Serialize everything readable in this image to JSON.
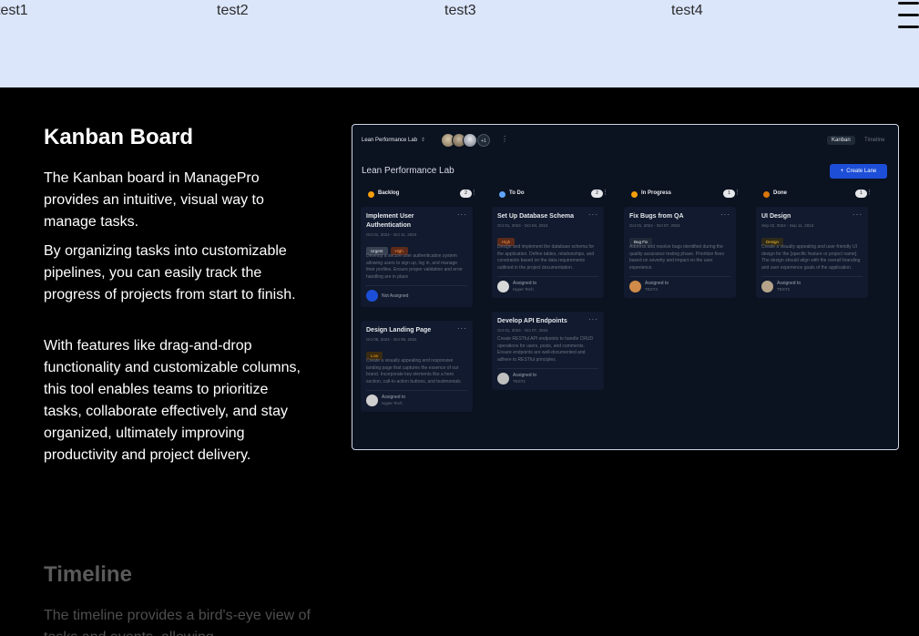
{
  "nav": {
    "links": [
      "test1",
      "test2",
      "test3",
      "test4"
    ]
  },
  "kanban_section": {
    "title": "Kanban Board",
    "paragraphs": [
      "The Kanban board in ManagePro provides an intuitive, visual way to manage tasks.",
      "By organizing tasks into customizable pipelines, you can easily track the progress of projects from start to finish.",
      "With features like drag-and-drop functionality and customizable columns, this tool enables teams to prioritize tasks, collaborate effectively, and stay organized, ultimately improving productivity and project delivery."
    ]
  },
  "timeline_section": {
    "title": "Timeline",
    "paragraph": "The timeline provides a bird's-eye view of tasks and events, allowing"
  },
  "board": {
    "project_selector": "Lean Performance Lab",
    "avatar_more": "+1",
    "tabs": [
      "Kanban",
      "Timeline"
    ],
    "title": "Lean Performance Lab",
    "create_lane": "Create Lane",
    "lanes": [
      {
        "name": "Backlog",
        "count": "2",
        "color": "#f59e0b",
        "cards": [
          {
            "title": "Implement User Authentication",
            "date": "Oct 01, 2024 - Oct 11, 2024",
            "tags": [
              "Urgent",
              "High"
            ],
            "body": "Develop a secure user authentication system allowing users to sign up, log in, and manage their profiles. Ensure proper validation and error handling are in place",
            "assignee_label": "Not Assigned",
            "assignee_name": ""
          },
          {
            "title": "Design Landing Page",
            "date": "Oct 05, 2024 - Oct 09, 2024",
            "tags": [
              "Low"
            ],
            "body": "Create a visually appealing and responsive landing page that captures the essence of our brand. Incorporate key elements like a hero section, call-to-action buttons, and testimonials.",
            "assignee_label": "Assigned to",
            "assignee_name": "Hyper Tech"
          }
        ]
      },
      {
        "name": "To Do",
        "count": "2",
        "color": "#60a5fa",
        "cards": [
          {
            "title": "Set Up Database Schema",
            "date": "Oct 01, 2024 - Oct 04, 2024",
            "tags": [
              "High"
            ],
            "body": "Design and implement the database schema for the application. Define tables, relationships, and constraints based on the data requirements outlined in the project documentation.",
            "assignee_label": "Assigned to",
            "assignee_name": "Hyper Tech"
          },
          {
            "title": "Develop API Endpoints",
            "date": "Oct 01, 2024 - Oct 07, 2024",
            "tags": [],
            "body": "Create RESTful API endpoints to handle CRUD operations for users, posts, and comments. Ensure endpoints are well-documented and adhere to RESTful principles.",
            "assignee_label": "Assigned to",
            "assignee_name": "TEST1"
          }
        ]
      },
      {
        "name": "In Progress",
        "count": "1",
        "color": "#f59e0b",
        "cards": [
          {
            "title": "Fix Bugs from QA",
            "date": "Oct 01, 2024 - Oct 07, 2024",
            "tags": [
              "Bug Fix"
            ],
            "body": "Address and resolve bugs identified during the quality assurance testing phase. Prioritize fixes based on severity and impact on the user experience.",
            "assignee_label": "Assigned to",
            "assignee_name": "TEST4"
          }
        ]
      },
      {
        "name": "Done",
        "count": "1",
        "color": "#d97706",
        "cards": [
          {
            "title": "UI Design",
            "date": "Sep 02, 2024 - Sep 11, 2024",
            "tags": [
              "Design"
            ],
            "body": "Create a visually appealing and user-friendly UI design for the [specific feature or project name]. The design should align with the overall branding and user experience goals of the application.",
            "assignee_label": "Assigned to",
            "assignee_name": "TEST2"
          }
        ]
      }
    ],
    "tag_colors": {
      "Urgent": "#374151",
      "High": "#5b2a1a",
      "Low": "#3a2a12",
      "Bug Fix": "#1f2937",
      "Design": "#2e2a1a"
    },
    "tag_text_colors": {
      "Urgent": "#e5e7eb",
      "High": "#fb923c",
      "Low": "#f59e0b",
      "Bug Fix": "#e5e7eb",
      "Design": "#fbbf24"
    }
  }
}
